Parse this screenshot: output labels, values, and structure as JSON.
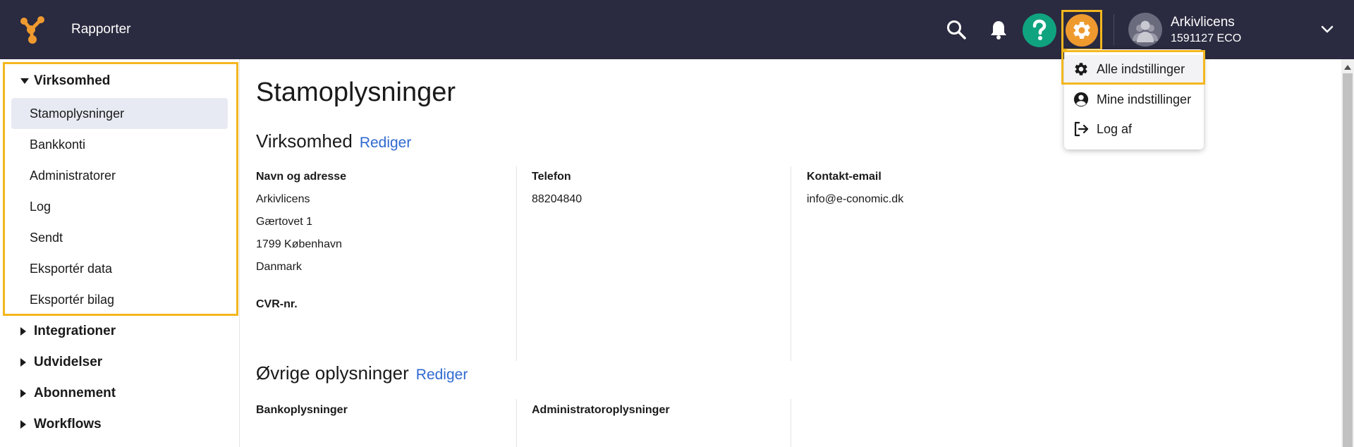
{
  "header": {
    "app_title": "Rapporter",
    "account_name": "Arkivlicens",
    "account_id": "1591127 ECO",
    "colors": {
      "bar": "#2a2a40",
      "help": "#10a37f",
      "settings": "#ef9a2f",
      "highlight": "#f3b71f",
      "logo": "#ef9a2f"
    }
  },
  "settings_menu": {
    "items": [
      {
        "label": "Alle indstillinger",
        "icon": "gear-icon"
      },
      {
        "label": "Mine indstillinger",
        "icon": "user-circle-icon"
      },
      {
        "label": "Log af",
        "icon": "logout-icon"
      }
    ]
  },
  "sidebar": {
    "groups": [
      {
        "label": "Virksomhed",
        "expanded": true,
        "items": [
          {
            "label": "Stamoplysninger",
            "active": true
          },
          {
            "label": "Bankkonti"
          },
          {
            "label": "Administratorer"
          },
          {
            "label": "Log"
          },
          {
            "label": "Sendt"
          },
          {
            "label": "Eksportér data"
          },
          {
            "label": "Eksportér bilag"
          }
        ]
      },
      {
        "label": "Integrationer",
        "expanded": false
      },
      {
        "label": "Udvidelser",
        "expanded": false
      },
      {
        "label": "Abonnement",
        "expanded": false
      },
      {
        "label": "Workflows",
        "expanded": false
      }
    ]
  },
  "main": {
    "page_title": "Stamoplysninger",
    "company_section": {
      "title": "Virksomhed",
      "edit_label": "Rediger",
      "columns": [
        {
          "label": "Navn og adresse",
          "lines": [
            "Arkivlicens",
            "Gærtovet 1",
            "1799 København",
            "Danmark"
          ]
        },
        {
          "label": "Telefon",
          "lines": [
            "88204840"
          ]
        },
        {
          "label": "Kontakt-email",
          "lines": [
            "info@e-conomic.dk"
          ]
        }
      ],
      "cvr_label": "CVR-nr."
    },
    "other_section": {
      "title": "Øvrige oplysninger",
      "edit_label": "Rediger",
      "columns": [
        {
          "label": "Bankoplysninger"
        },
        {
          "label": "Administratoroplysninger"
        }
      ]
    }
  }
}
